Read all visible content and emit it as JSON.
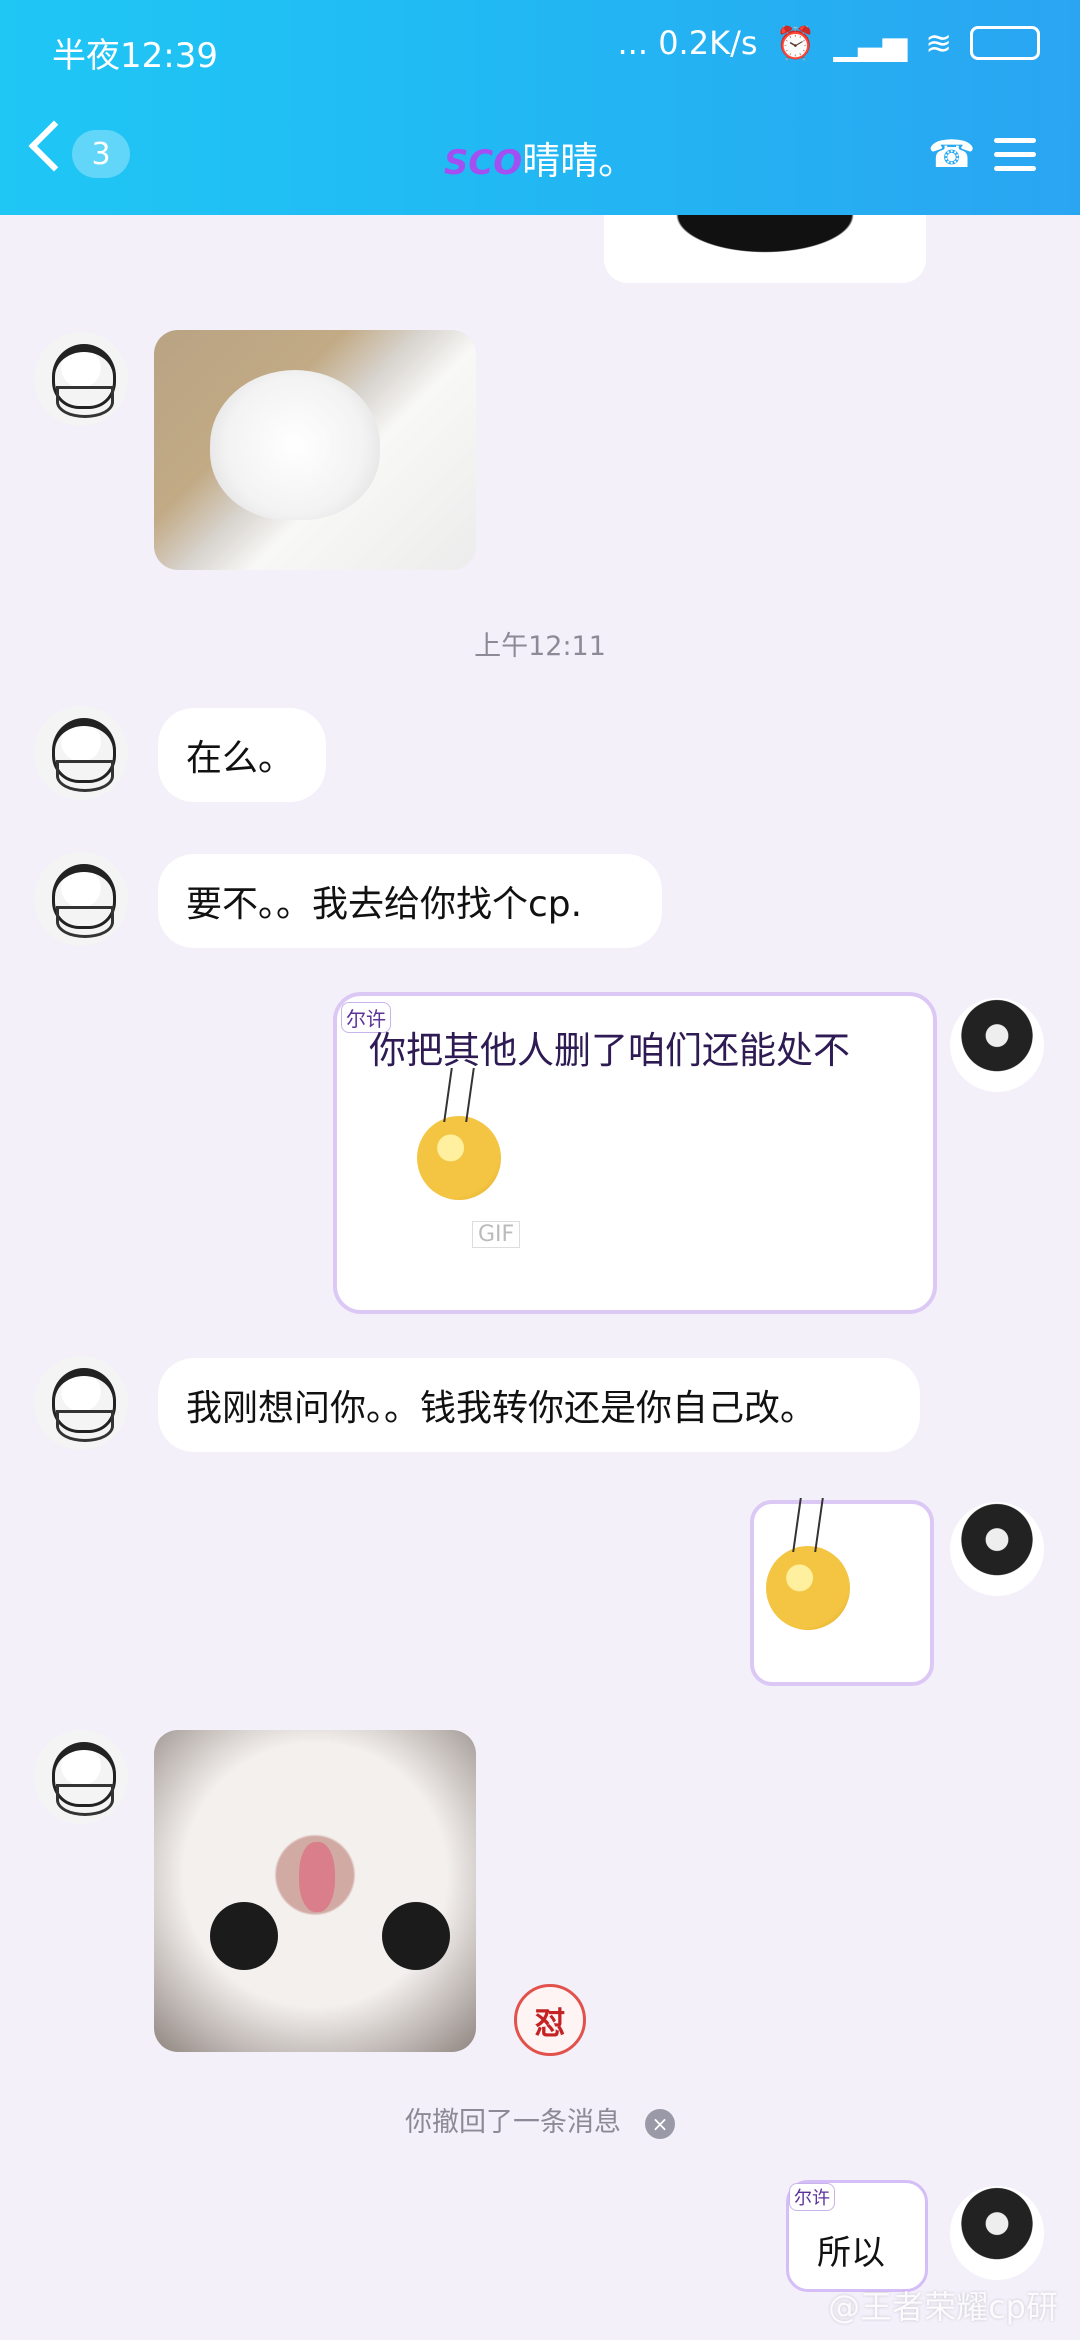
{
  "status_bar": {
    "time": "半夜12:39",
    "network": "... 0.2K/s"
  },
  "header": {
    "back_badge": "3",
    "title_tag": "SCO",
    "title": "晴晴。"
  },
  "messages": {
    "timestamp": "上午12:11",
    "msg1": "在么。",
    "msg2": "要不。。我去给你找个cp.",
    "card_tag": "尔许",
    "card_text": "你把其他人删了咱们还能处不",
    "gif_label": "GIF",
    "msg3": "我刚想问你。。钱我转你还是你自己改。",
    "badge_icon": "怼",
    "recall_text": "你撤回了一条消息",
    "small_card_tag": "尔许",
    "small_card_text": "所以"
  },
  "watermark": "@王者荣耀cp研"
}
